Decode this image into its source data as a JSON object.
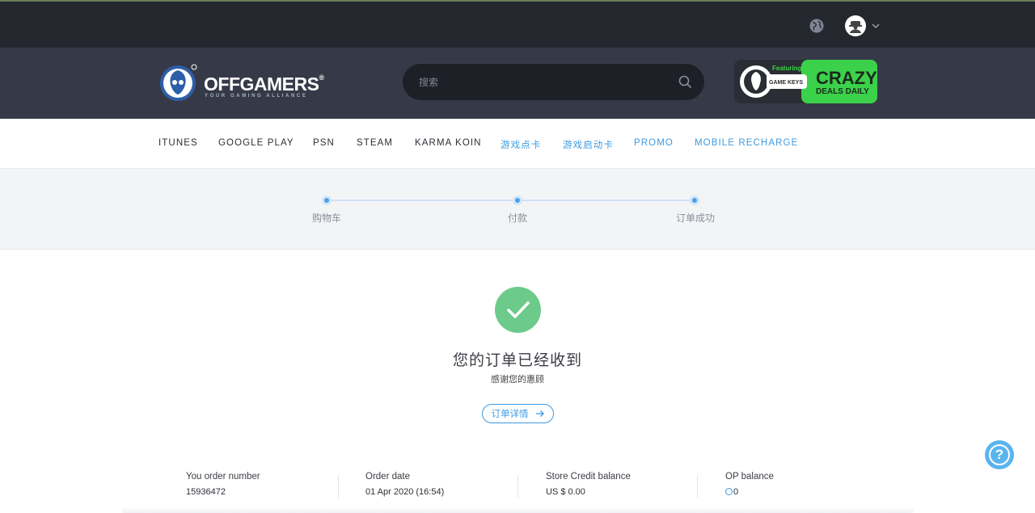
{
  "header": {
    "brand_name": "OFFGAMERS",
    "brand_tagline": "YOUR GAMING ALLIANCE",
    "search_placeholder": "搜索",
    "promo": {
      "line1": "Featuring",
      "badge": "GAME KEYS",
      "line2": "CRAZY",
      "line3": "DEALS DAILY"
    }
  },
  "nav": {
    "items": [
      {
        "label": "ITUNES"
      },
      {
        "label": "GOOGLE PLAY"
      },
      {
        "label": "PSN"
      },
      {
        "label": "STEAM"
      },
      {
        "label": "KARMA KOIN"
      },
      {
        "label": "游戏点卡"
      },
      {
        "label": "游戏启动卡"
      },
      {
        "label": "PROMO"
      },
      {
        "label": "MOBILE RECHARGE"
      }
    ]
  },
  "steps": [
    {
      "label": "购物车"
    },
    {
      "label": "付款"
    },
    {
      "label": "订单成功"
    }
  ],
  "success": {
    "title": "您的订单已经收到",
    "subtitle": "感谢您的惠顾",
    "details_button": "订单详情"
  },
  "summary": [
    {
      "label": "You order number",
      "value": "15936472"
    },
    {
      "label": "Order date",
      "value": "01 Apr 2020 (16:54)"
    },
    {
      "label": "Store Credit balance",
      "value": "US $ 0.00"
    },
    {
      "label": "OP balance",
      "value": "0"
    }
  ],
  "colors": {
    "accent": "#3d9be0",
    "success": "#6ccb8a",
    "topbar": "#24272d",
    "header": "#363a48",
    "promo_green": "#3bd14a"
  },
  "icons": [
    "globe-icon",
    "avatar-icon",
    "chevron-down-icon",
    "search-icon",
    "check-icon",
    "arrow-right-icon",
    "help-icon",
    "op-coin-icon"
  ]
}
